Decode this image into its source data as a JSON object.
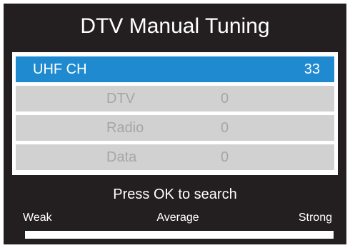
{
  "title": "DTV Manual Tuning",
  "channel": {
    "label": "UHF CH",
    "value": "33"
  },
  "results": [
    {
      "label": "DTV",
      "value": "0"
    },
    {
      "label": "Radio",
      "value": "0"
    },
    {
      "label": "Data",
      "value": "0"
    }
  ],
  "prompt": "Press OK to search",
  "signal": {
    "weak_label": "Weak",
    "average_label": "Average",
    "strong_label": "Strong",
    "level": 0
  },
  "colors": {
    "background": "#231f20",
    "selected_row": "#1f8ad0",
    "info_row": "#d1d1d1",
    "info_text": "#a6a6a6"
  }
}
